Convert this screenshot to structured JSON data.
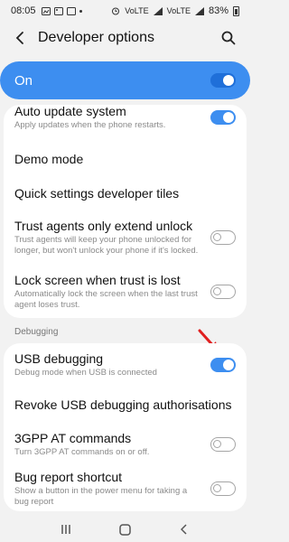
{
  "status_bar": {
    "time": "08:05",
    "network_1": "VoLTE",
    "network_2": "VoLTE",
    "battery": "83%"
  },
  "app_bar": {
    "title": "Developer options"
  },
  "master_switch": {
    "label": "On",
    "enabled": true
  },
  "settings_card_1": [
    {
      "title": "Auto update system",
      "subtitle": "Apply updates when the phone restarts.",
      "toggle": "on"
    },
    {
      "title": "Demo mode"
    },
    {
      "title": "Quick settings developer tiles"
    },
    {
      "title": "Trust agents only extend unlock",
      "subtitle": "Trust agents will keep your phone unlocked for longer, but won't unlock your phone if it's locked.",
      "toggle": "off"
    },
    {
      "title": "Lock screen when trust is lost",
      "subtitle": "Automatically lock the screen when the last trust agent loses trust.",
      "toggle": "off"
    }
  ],
  "debugging_section": {
    "label": "Debugging",
    "items": [
      {
        "title": "USB debugging",
        "subtitle": "Debug mode when USB is connected",
        "toggle": "on"
      },
      {
        "title": "Revoke USB debugging authorisations"
      },
      {
        "title": "3GPP AT commands",
        "subtitle": "Turn 3GPP AT commands on or off.",
        "toggle": "off"
      },
      {
        "title": "Bug report shortcut",
        "subtitle": "Show a button in the power menu for taking a bug report",
        "toggle": "off"
      }
    ]
  },
  "colors": {
    "accent": "#3d8ef0",
    "annotation_arrow": "#e02020"
  }
}
